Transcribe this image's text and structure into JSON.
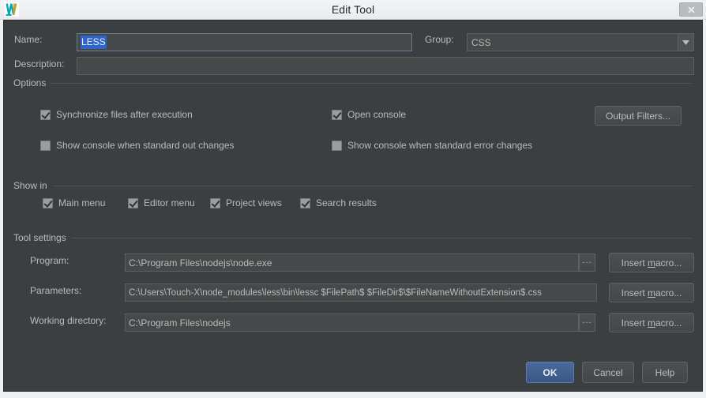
{
  "window": {
    "title": "Edit Tool",
    "app_icon": "webstorm-logo-icon",
    "close_icon": "close-icon"
  },
  "form": {
    "name": {
      "label": "Name:",
      "value": "LESS",
      "selected": true
    },
    "group": {
      "label": "Group:",
      "value": "CSS",
      "arrow_icon": "chevron-down-icon"
    },
    "description": {
      "label": "Description:",
      "value": "",
      "placeholder": ""
    }
  },
  "options": {
    "title": "Options",
    "checkboxes": [
      {
        "label": "Synchronize files after execution",
        "checked": true
      },
      {
        "label": "Open console",
        "checked": true
      },
      {
        "label": "Show console when standard out changes",
        "checked": false
      },
      {
        "label": "Show console when standard error changes",
        "checked": false
      }
    ],
    "output_filters_button": "Output Filters..."
  },
  "show_in": {
    "title": "Show in",
    "checkboxes": [
      {
        "label": "Main menu",
        "checked": true
      },
      {
        "label": "Editor menu",
        "checked": true
      },
      {
        "label": "Project views",
        "checked": true
      },
      {
        "label": "Search results",
        "checked": true
      }
    ]
  },
  "tool_settings": {
    "title": "Tool settings",
    "program": {
      "label": "Program:",
      "value": "C:\\Program Files\\nodejs\\node.exe",
      "browse_label": "...",
      "macro_button": "Insert macro..."
    },
    "parameters": {
      "label": "Parameters:",
      "value": "C:\\Users\\Touch-X\\node_modules\\less\\bin\\lessc $FilePath$ $FileDir$\\$FileNameWithoutExtension$.css",
      "macro_button": "Insert macro..."
    },
    "working_directory": {
      "label": "Working directory:",
      "value": "C:\\Program Files\\nodejs",
      "browse_label": "...",
      "macro_button": "Insert macro..."
    }
  },
  "footer": {
    "ok": "OK",
    "cancel": "Cancel",
    "help": "Help"
  },
  "colors": {
    "dialog_bg": "#3c3f41",
    "field_bg": "#45494a",
    "titlebar_bg": "#eef0f1",
    "text": "#bbbbbb",
    "selection": "#2f65ca",
    "default_button": "#4a6a9c"
  }
}
